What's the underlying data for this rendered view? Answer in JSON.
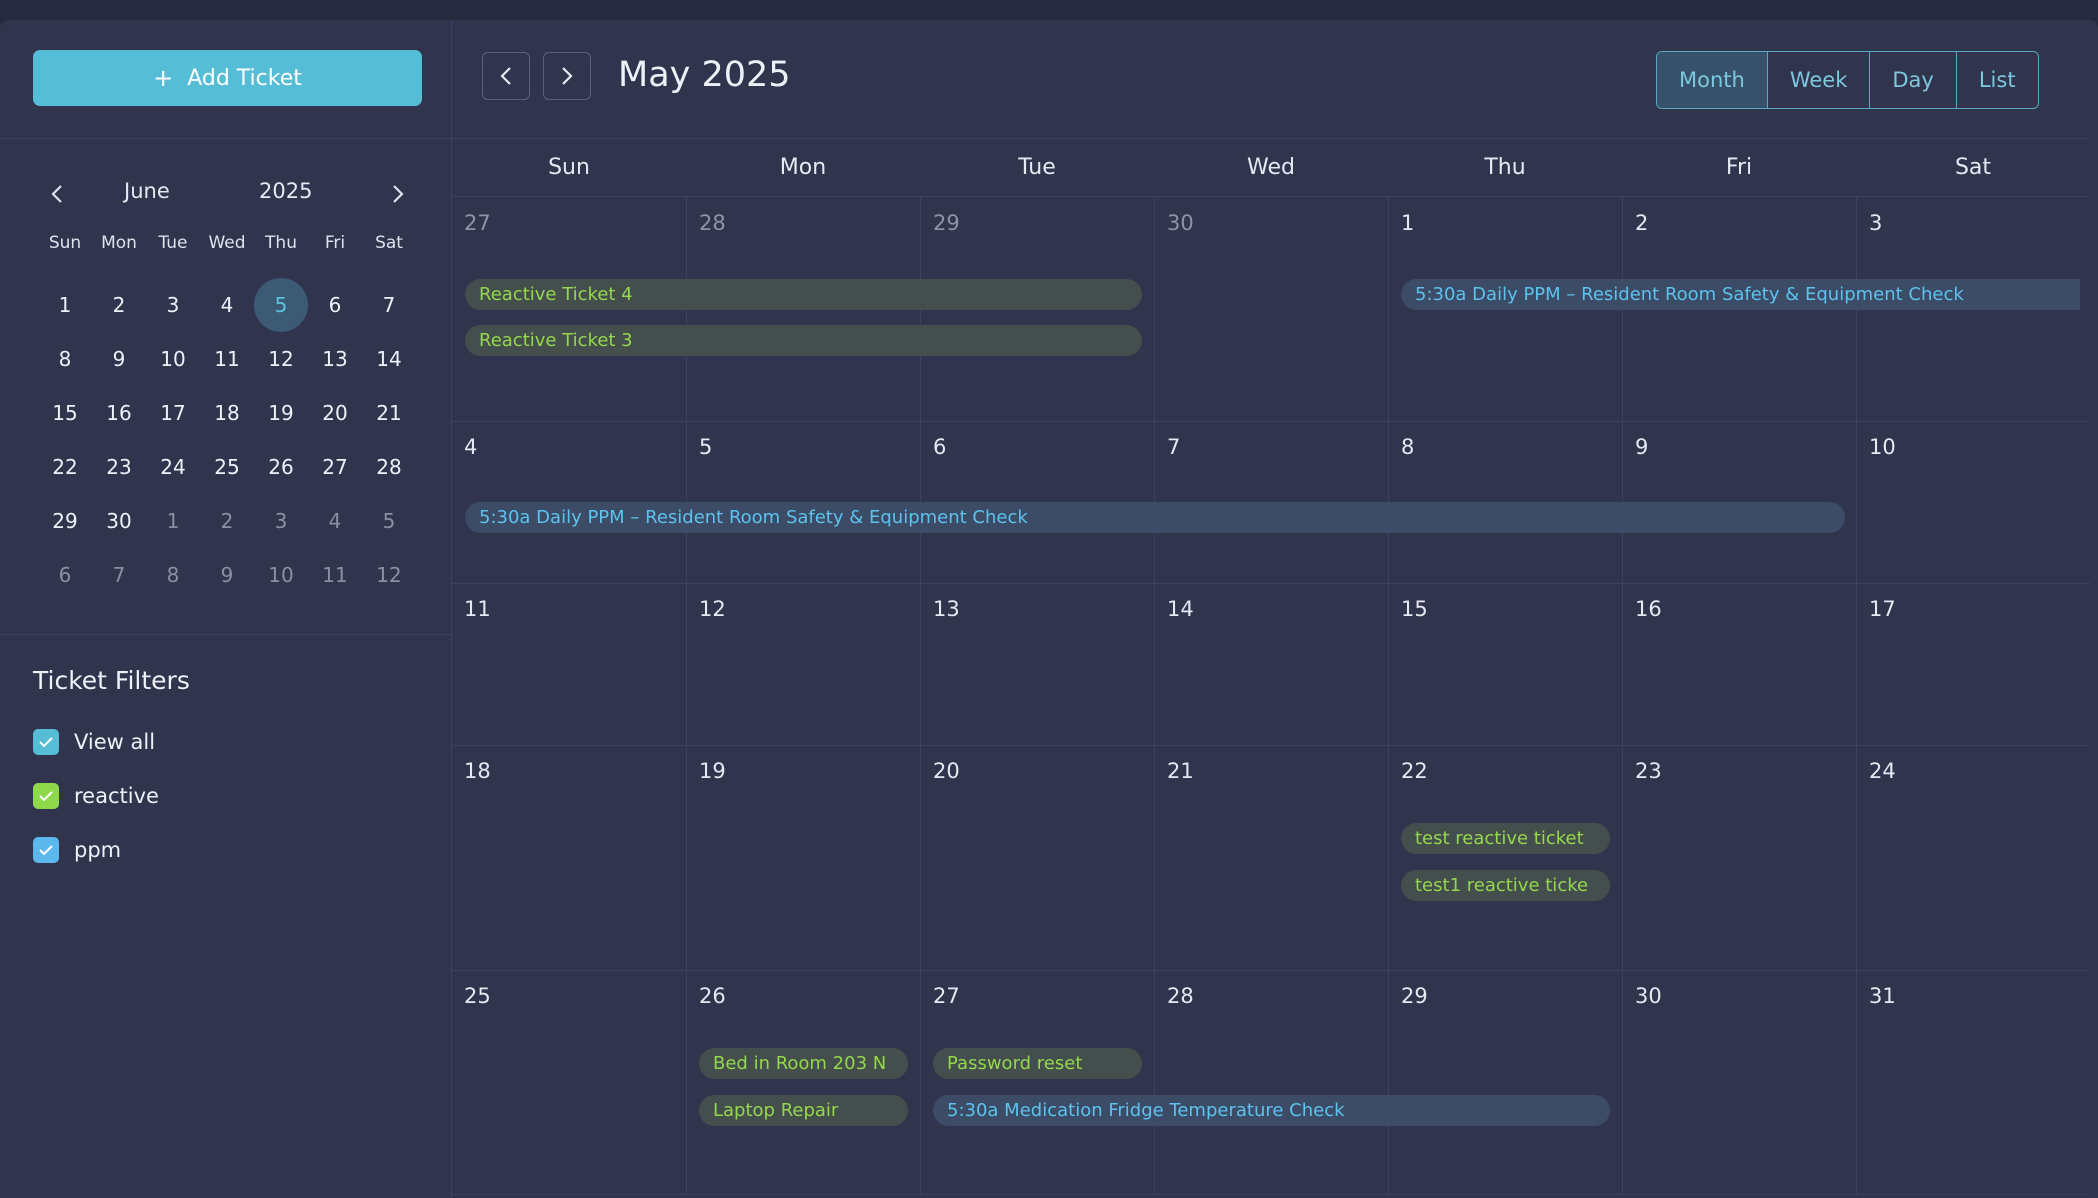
{
  "sidebar": {
    "add_button_label": "Add Ticket",
    "mini_calendar": {
      "month": "June",
      "year": "2025",
      "weekdays": [
        "Sun",
        "Mon",
        "Tue",
        "Wed",
        "Thu",
        "Fri",
        "Sat"
      ],
      "weeks": [
        [
          "1",
          "2",
          "3",
          "4",
          "5",
          "6",
          "7"
        ],
        [
          "8",
          "9",
          "10",
          "11",
          "12",
          "13",
          "14"
        ],
        [
          "15",
          "16",
          "17",
          "18",
          "19",
          "20",
          "21"
        ],
        [
          "22",
          "23",
          "24",
          "25",
          "26",
          "27",
          "28"
        ],
        [
          "29",
          "30",
          "1",
          "2",
          "3",
          "4",
          "5"
        ],
        [
          "6",
          "7",
          "8",
          "9",
          "10",
          "11",
          "12"
        ]
      ],
      "today": "5"
    },
    "filters": {
      "title": "Ticket Filters",
      "items": [
        {
          "label": "View all",
          "color": "#56bdd6"
        },
        {
          "label": "reactive",
          "color": "#8ed94a"
        },
        {
          "label": "ppm",
          "color": "#5cb8ec"
        }
      ]
    }
  },
  "toolbar": {
    "title": "May 2025",
    "views": [
      "Month",
      "Week",
      "Day",
      "List"
    ],
    "active_view": "Month"
  },
  "calendar": {
    "weekdays": [
      "Sun",
      "Mon",
      "Tue",
      "Wed",
      "Thu",
      "Fri",
      "Sat"
    ],
    "weeks": [
      {
        "days": [
          "27",
          "28",
          "29",
          "30",
          "1",
          "2",
          "3"
        ]
      },
      {
        "days": [
          "4",
          "5",
          "6",
          "7",
          "8",
          "9",
          "10"
        ]
      },
      {
        "days": [
          "11",
          "12",
          "13",
          "14",
          "15",
          "16",
          "17"
        ]
      },
      {
        "days": [
          "18",
          "19",
          "20",
          "21",
          "22",
          "23",
          "24"
        ]
      },
      {
        "days": [
          "25",
          "26",
          "27",
          "28",
          "29",
          "30",
          "31"
        ]
      }
    ],
    "events": {
      "w0_a": "Reactive Ticket 4",
      "w0_b": "Reactive Ticket 3",
      "w0_ppm": "5:30a  Daily PPM – Resident Room Safety & Equipment Check",
      "w1_ppm": "5:30a  Daily PPM – Resident Room Safety & Equipment Check",
      "w3_a": "test reactive ticket",
      "w3_b": "test1 reactive ticke",
      "w4_a": "Bed in Room 203 N",
      "w4_b": "Laptop Repair",
      "w4_c": "Password reset",
      "w4_ppm": "5:30a  Medication Fridge Temperature Check"
    }
  },
  "colors": {
    "accent": "#56bdd6",
    "reactive_text": "#94d84c",
    "ppm_text": "#5cc3ef"
  }
}
